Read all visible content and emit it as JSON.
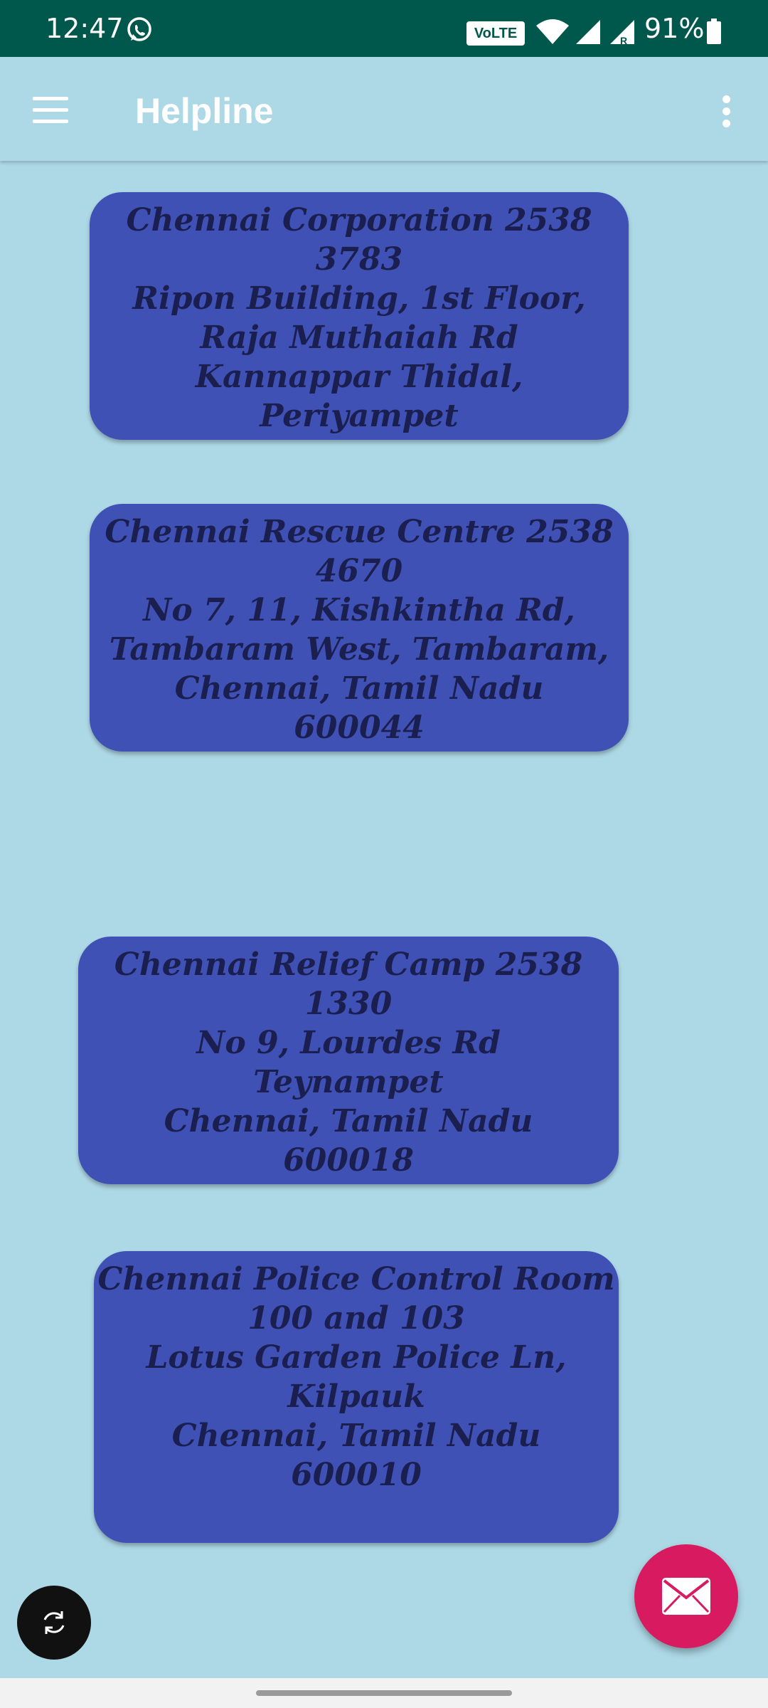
{
  "status_bar": {
    "time": "12:47",
    "volte": "VoLTE",
    "battery": "91%",
    "icons": [
      "whatsapp-icon",
      "wifi-icon",
      "signal-icon",
      "signal-roaming-icon",
      "battery-icon"
    ]
  },
  "app_bar": {
    "title": "Helpline",
    "menu_icon": "hamburger-menu-icon",
    "overflow_icon": "more-vert-icon"
  },
  "cards": [
    {
      "lines": [
        "Chennai Corporation 2538",
        "3783",
        "Ripon Building, 1st Floor,",
        "Raja Muthaiah Rd",
        "Kannappar Thidal,",
        "Periyampet"
      ]
    },
    {
      "lines": [
        "Chennai Rescue Centre 2538",
        "4670",
        "No 7, 11, Kishkintha Rd,",
        "Tambaram West, Tambaram,",
        "Chennai, Tamil Nadu",
        "600044"
      ]
    },
    {
      "lines": [
        "Chennai Relief Camp 2538 1330",
        "No 9, Lourdes Rd",
        "Teynampet",
        "Chennai, Tamil Nadu",
        "600018"
      ]
    },
    {
      "lines": [
        "Chennai Police Control Room",
        "100 and 103",
        "Lotus Garden Police Ln,",
        "Kilpauk",
        "Chennai, Tamil Nadu",
        "600010"
      ]
    }
  ],
  "actions": {
    "refresh_icon": "refresh-icon",
    "fab_icon": "mail-icon"
  },
  "colors": {
    "status_bar": "#00574b",
    "background": "#add8e6",
    "card": "#3f51b5",
    "card_text": "#1b1f4f",
    "fab": "#d81b60"
  }
}
